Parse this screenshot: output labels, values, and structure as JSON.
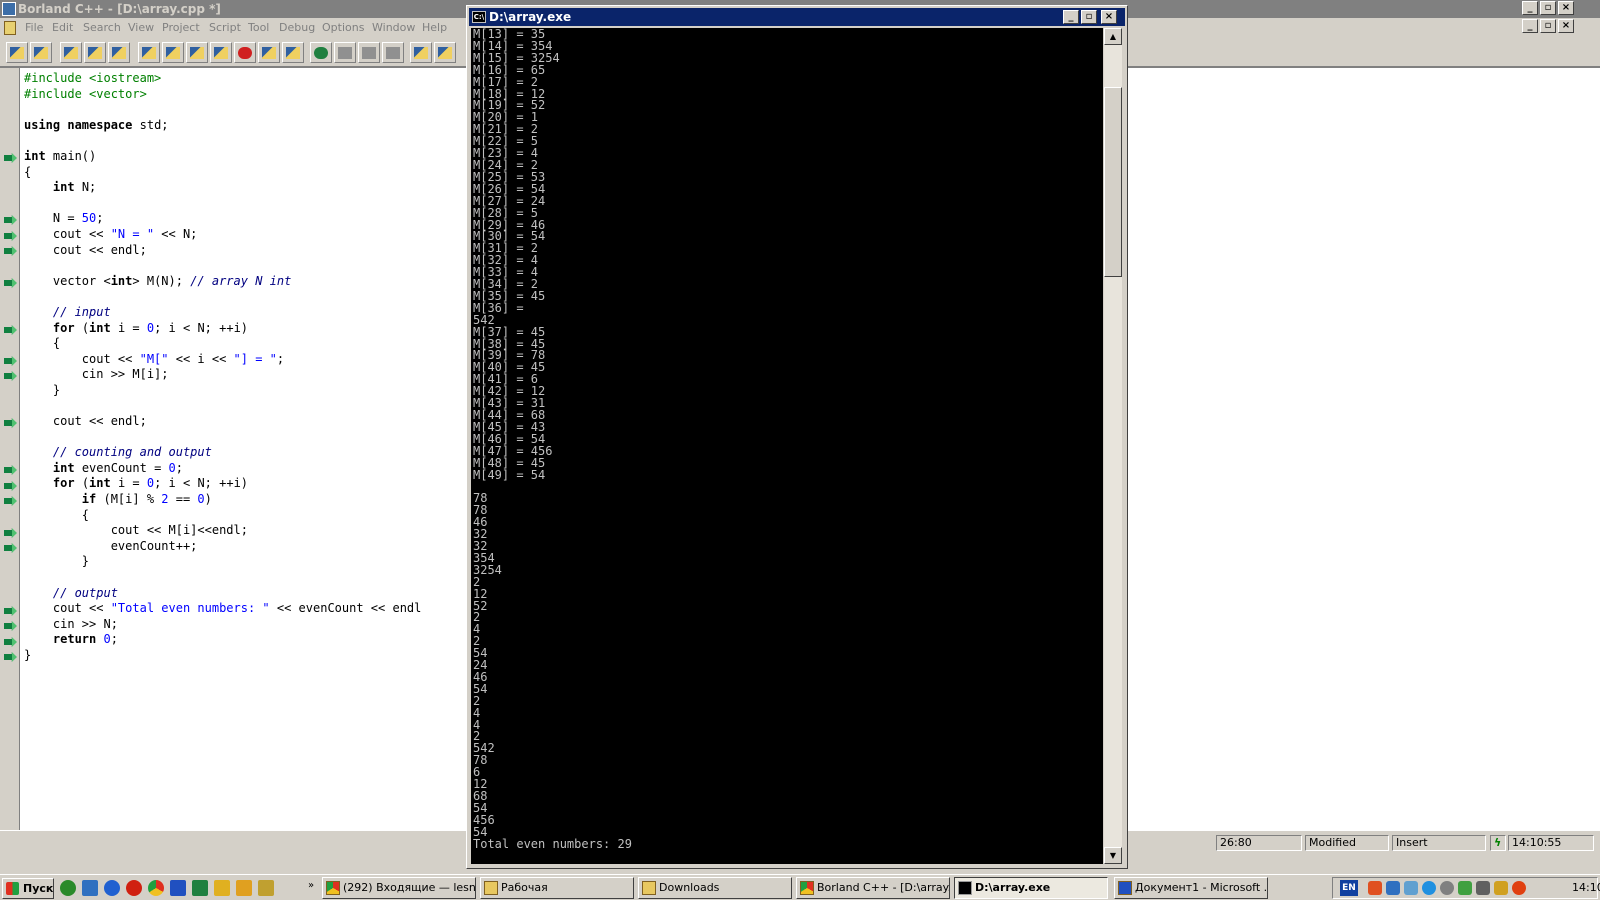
{
  "ide": {
    "title": "Borland C++ - [D:\\array.cpp *]",
    "menu": [
      "File",
      "Edit",
      "Search",
      "View",
      "Project",
      "Script",
      "Tool",
      "Debug",
      "Options",
      "Window",
      "Help"
    ],
    "status": {
      "position": "26:80",
      "modified": "Modified",
      "mode": "Insert",
      "time": "14:10:55"
    }
  },
  "code_lines": [
    "#include <iostream>",
    "#include <vector>",
    "",
    "using namespace std;",
    "",
    "int main()",
    "{",
    "    int N;",
    "",
    "    N = 50;",
    "    cout << \"N = \" << N;",
    "    cout << endl;",
    "",
    "    vector <int> M(N); // array N int",
    "",
    "    // input",
    "    for (int i = 0; i < N; ++i)",
    "    {",
    "        cout << \"M[\" << i << \"] = \";",
    "        cin >> M[i];",
    "    }",
    "",
    "    cout << endl;",
    "",
    "    // counting and output",
    "    int evenCount = 0;",
    "    for (int i = 0; i < N; ++i)",
    "        if (M[i] % 2 == 0)",
    "        {",
    "            cout << M[i]<<endl;",
    "            evenCount++;",
    "        }",
    "",
    "    // output",
    "    cout << \"Total even numbers: \" << evenCount << endl",
    "    cin >> N;",
    "    return 0;",
    "}"
  ],
  "console": {
    "title": "D:\\array.exe",
    "lines": [
      "M[13] = 35",
      "M[14] = 354",
      "M[15] = 3254",
      "M[16] = 65",
      "M[17] = 2",
      "M[18] = 12",
      "M[19] = 52",
      "M[20] = 1",
      "M[21] = 2",
      "M[22] = 5",
      "M[23] = 4",
      "M[24] = 2",
      "M[25] = 53",
      "M[26] = 54",
      "M[27] = 24",
      "M[28] = 5",
      "M[29] = 46",
      "M[30] = 54",
      "M[31] = 2",
      "M[32] = 4",
      "M[33] = 4",
      "M[34] = 2",
      "M[35] = 45",
      "M[36] =",
      "542",
      "M[37] = 45",
      "M[38] = 45",
      "M[39] = 78",
      "M[40] = 45",
      "M[41] = 6",
      "M[42] = 12",
      "M[43] = 31",
      "M[44] = 68",
      "M[45] = 43",
      "M[46] = 54",
      "M[47] = 456",
      "M[48] = 45",
      "M[49] = 54",
      "",
      "78",
      "78",
      "46",
      "32",
      "32",
      "354",
      "3254",
      "2",
      "12",
      "52",
      "2",
      "4",
      "2",
      "54",
      "24",
      "46",
      "54",
      "2",
      "4",
      "4",
      "2",
      "542",
      "78",
      "6",
      "12",
      "68",
      "54",
      "456",
      "54",
      "Total even numbers: 29"
    ]
  },
  "taskbar": {
    "start": "Пуск",
    "buttons": [
      {
        "label": "(292) Входящие — lesn...",
        "kind": "br"
      },
      {
        "label": "Рабочая",
        "kind": "fold"
      },
      {
        "label": "Downloads",
        "kind": "fold"
      },
      {
        "label": "Borland C++ - [D:\\array...",
        "kind": "br"
      },
      {
        "label": "D:\\array.exe",
        "kind": "con",
        "active": true
      },
      {
        "label": "Документ1 - Microsoft ...",
        "kind": "wd"
      }
    ],
    "lang": "EN",
    "clock": "14:10"
  }
}
